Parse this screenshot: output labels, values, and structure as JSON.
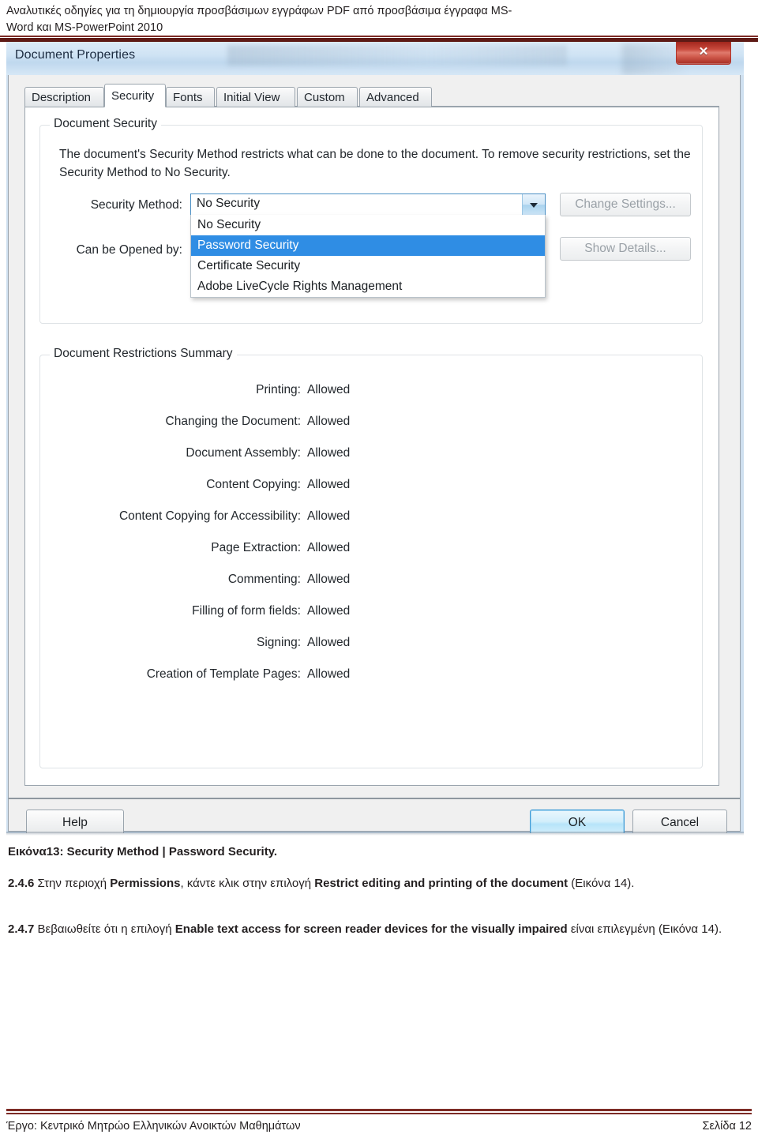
{
  "document_header": {
    "line1": "Αναλυτικές οδηγίες για τη δημιουργία προσβάσιμων εγγράφων PDF από προσβάσιμα έγγραφα MS-",
    "line2": "Word και MS-PowerPoint 2010"
  },
  "dialog": {
    "title": "Document Properties",
    "close_label": "✕",
    "tabs": [
      {
        "label": "Description",
        "active": false
      },
      {
        "label": "Security",
        "active": true
      },
      {
        "label": "Fonts",
        "active": false
      },
      {
        "label": "Initial View",
        "active": false
      },
      {
        "label": "Custom",
        "active": false
      },
      {
        "label": "Advanced",
        "active": false
      }
    ],
    "document_security": {
      "legend": "Document Security",
      "description": "The document's Security Method restricts what can be done to the document. To remove security restrictions, set the Security Method to No Security.",
      "security_method_label": "Security Method:",
      "security_method_value": "No Security",
      "can_be_opened_by_label": "Can be Opened by:",
      "dropdown_options": [
        {
          "label": "No Security",
          "selected": false
        },
        {
          "label": "Password Security",
          "selected": true
        },
        {
          "label": "Certificate Security",
          "selected": false
        },
        {
          "label": "Adobe LiveCycle Rights Management",
          "selected": false
        }
      ],
      "change_settings_label": "Change Settings...",
      "show_details_label": "Show Details...",
      "highlight_color": "#2f8de4"
    },
    "restrictions": {
      "legend": "Document Restrictions Summary",
      "rows": [
        {
          "key": "Printing:",
          "value": "Allowed"
        },
        {
          "key": "Changing the Document:",
          "value": "Allowed"
        },
        {
          "key": "Document Assembly:",
          "value": "Allowed"
        },
        {
          "key": "Content Copying:",
          "value": "Allowed"
        },
        {
          "key": "Content Copying for Accessibility:",
          "value": "Allowed"
        },
        {
          "key": "Page Extraction:",
          "value": "Allowed"
        },
        {
          "key": "Commenting:",
          "value": "Allowed"
        },
        {
          "key": "Filling of form fields:",
          "value": "Allowed"
        },
        {
          "key": "Signing:",
          "value": "Allowed"
        },
        {
          "key": "Creation of Template Pages:",
          "value": "Allowed"
        }
      ]
    },
    "footer_buttons": {
      "help": "Help",
      "ok": "OK",
      "cancel": "Cancel"
    }
  },
  "caption": "Εικόνα13: Security Method | Password Security.",
  "steps": [
    {
      "number": "2.4.6",
      "html": "<span class=\"num\">2.4.6</span> Στην περιοχή <b>Permissions</b>, κάντε κλικ στην επιλογή <b>Restrict editing and printing of the document</b> (Εικόνα 14)."
    },
    {
      "number": "2.4.7",
      "html": "<span class=\"num\">2.4.7</span> Βεβαιωθείτε ότι η επιλογή <b>Enable text access for screen reader devices for the visually impaired</b> είναι επιλεγμένη (Εικόνα 14)."
    }
  ],
  "footer": {
    "left_prefix": "Έργο",
    "left": "Έργο: Κεντρικό Μητρώο Ελληνικών Ανοικτών Μαθημάτων",
    "right": "Σελίδα 12"
  }
}
